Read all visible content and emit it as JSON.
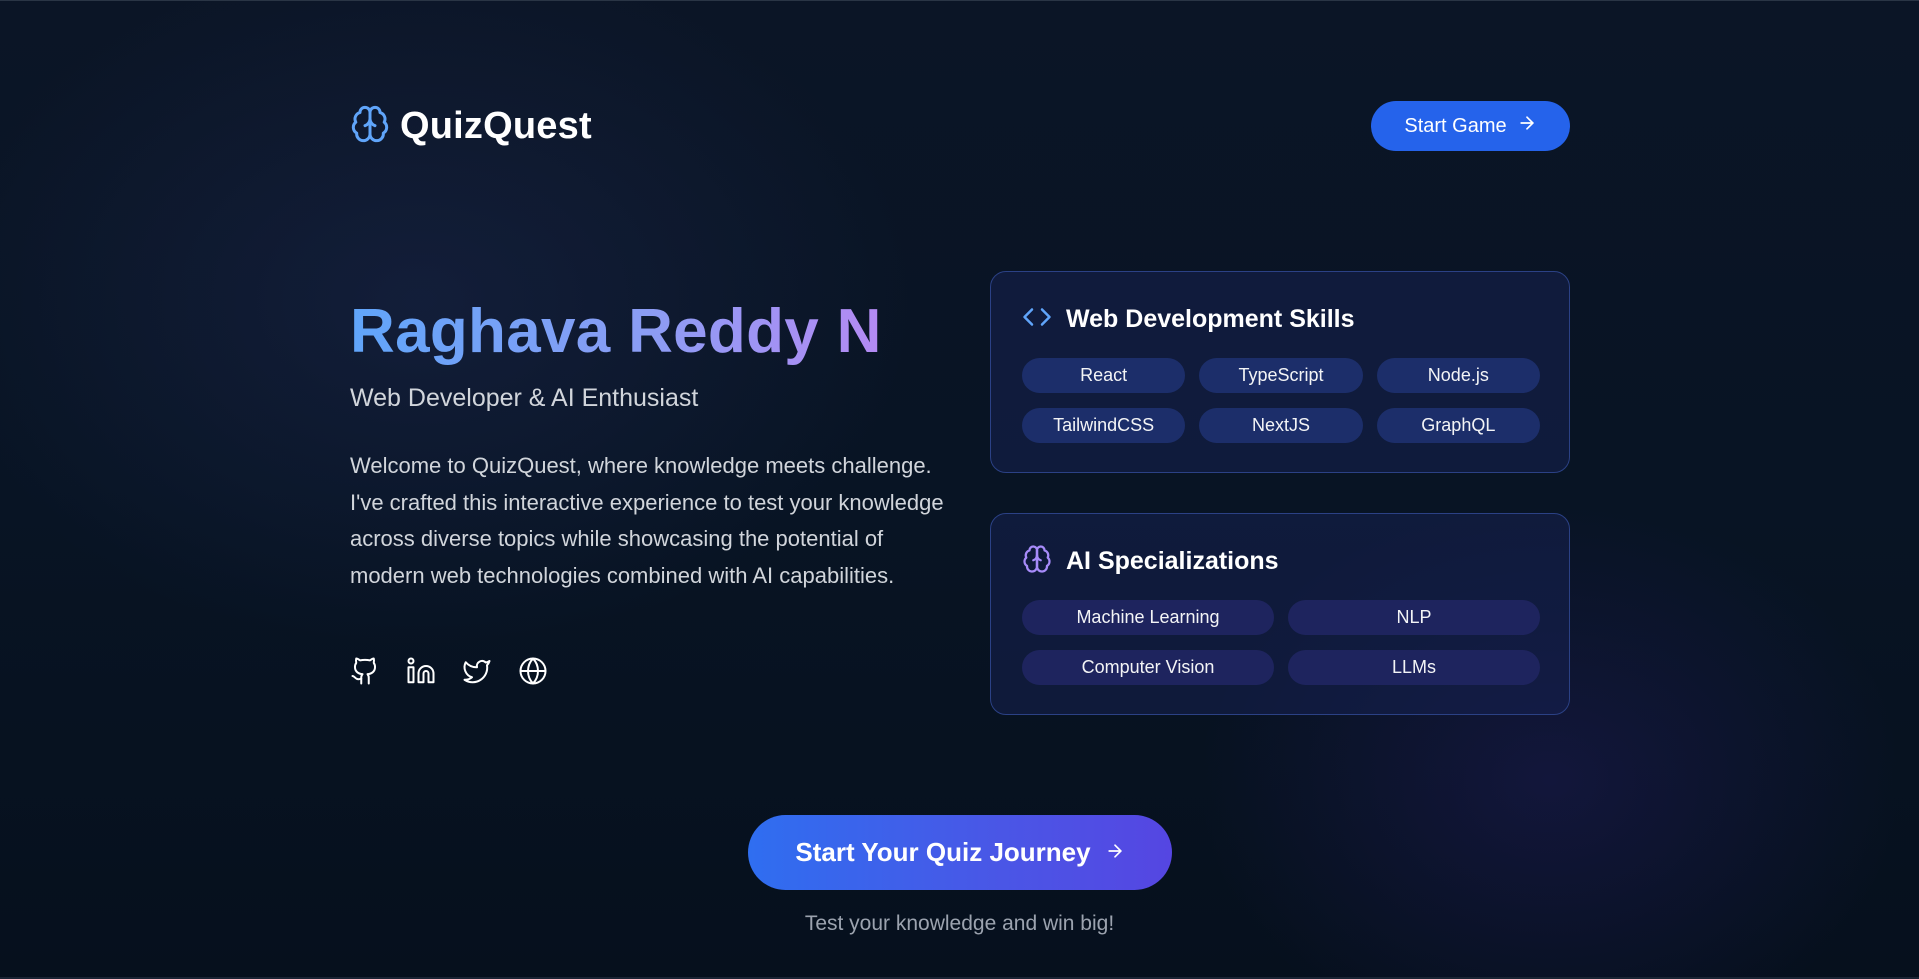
{
  "header": {
    "brand": "QuizQuest",
    "start_game_label": "Start Game"
  },
  "hero": {
    "name": "Raghava Reddy N",
    "subtitle": "Web Developer & AI Enthusiast",
    "description": "Welcome to QuizQuest, where knowledge meets challenge. I've crafted this interactive experience to test your knowledge across diverse topics while showcasing the potential of modern web technologies combined with AI capabilities.",
    "socials": [
      {
        "icon": "github-icon"
      },
      {
        "icon": "linkedin-icon"
      },
      {
        "icon": "twitter-icon"
      },
      {
        "icon": "globe-icon"
      }
    ]
  },
  "web_skills": {
    "title": "Web Development Skills",
    "icon": "code-icon",
    "items": [
      "React",
      "TypeScript",
      "Node.js",
      "TailwindCSS",
      "NextJS",
      "GraphQL"
    ]
  },
  "ai_skills": {
    "title": "AI Specializations",
    "icon": "brain-icon",
    "items": [
      "Machine Learning",
      "NLP",
      "Computer Vision",
      "LLMs"
    ]
  },
  "cta": {
    "label": "Start Your Quiz Journey",
    "tagline": "Test your knowledge and win big!"
  },
  "colors": {
    "accent_blue": "#2563eb",
    "gradient_start": "#60a5fa",
    "gradient_end": "#b48af3",
    "background": "#0b1526"
  }
}
